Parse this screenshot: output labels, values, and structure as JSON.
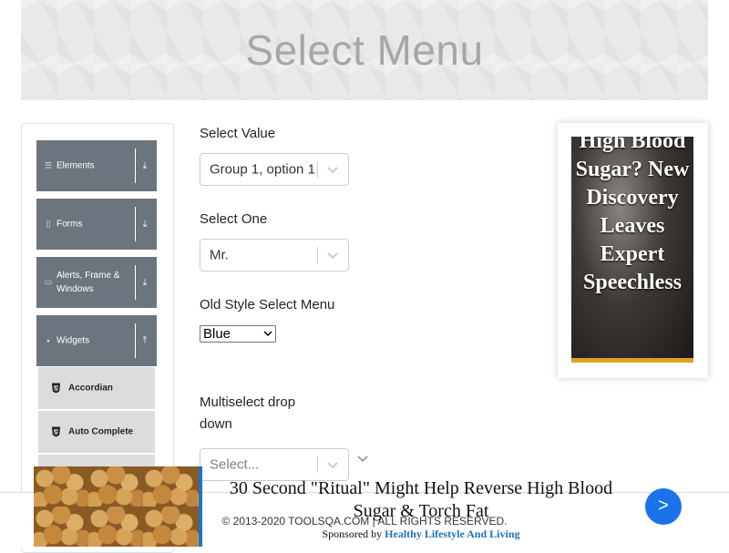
{
  "header": {
    "title": "Select Menu"
  },
  "sidebar": {
    "groups": [
      {
        "label": "Elements",
        "icon": "hamburger-icon",
        "arrow": "⤓"
      },
      {
        "label": "Forms",
        "icon": "form-icon",
        "arrow": "⤓"
      },
      {
        "label": "Alerts, Frame & Windows",
        "icon": "window-icon",
        "arrow": "⤓"
      },
      {
        "label": "Widgets",
        "icon": "widgets-icon",
        "arrow": "⤒"
      }
    ],
    "subitems": [
      {
        "label": "Accordian",
        "icon": "html5-icon"
      },
      {
        "label": "Auto Complete",
        "icon": "html5-icon"
      }
    ]
  },
  "form": {
    "select_value": {
      "label": "Select Value",
      "value": "Group 1, option 1"
    },
    "select_one": {
      "label": "Select One",
      "value": "Mr."
    },
    "old_style": {
      "label": "Old Style Select Menu",
      "value": "Blue"
    },
    "multiselect": {
      "label": "Multiselect drop down",
      "placeholder": "Select..."
    }
  },
  "ad_side": {
    "text": "High Blood Sugar? New Discovery Leaves Expert Speechless",
    "accent": "#e0a020"
  },
  "footer": {
    "copyright": "© 2013-2020 TOOLSQA.COM | ALL RIGHTS RESERVED."
  },
  "ad_bottom": {
    "headline": "30 Second \"Ritual\" Might Help Reverse High Blood Sugar & Torch Fat",
    "sponsored_prefix": "Sponsored by ",
    "sponsor_name": "Healthy Lifestyle And Living",
    "go_label": ">",
    "accent": "#1e73be"
  }
}
